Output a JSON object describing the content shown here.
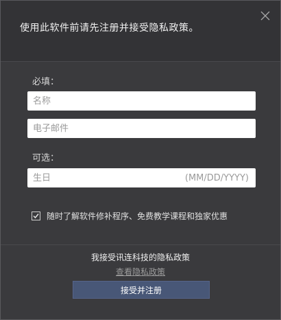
{
  "header": {
    "title": "使用此软件前请先注册并接受隐私政策。",
    "close_icon": "close-icon"
  },
  "form": {
    "required_label": "必填：",
    "name_placeholder": "名称",
    "email_placeholder": "电子邮件",
    "optional_label": "可选：",
    "birthday_placeholder": "生日",
    "birthday_format": "(MM/DD/YYYY)"
  },
  "consent": {
    "checked": true,
    "label": "随时了解软件修补程序、免费教学课程和独家优惠"
  },
  "footer": {
    "policy_title": "我接受讯连科技的隐私政策",
    "policy_link": "查看隐私政策",
    "accept_button": "接受并注册"
  },
  "colors": {
    "header_bg": "#333336",
    "body_bg": "#3a3a3d",
    "button_bg": "#485777"
  }
}
